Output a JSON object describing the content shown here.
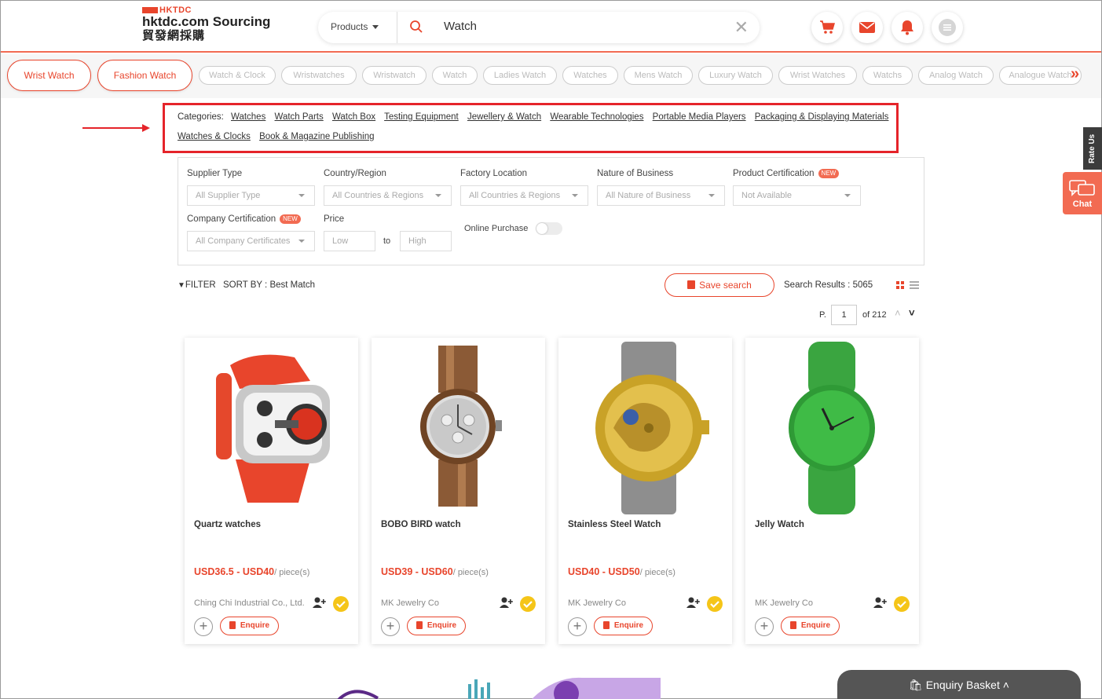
{
  "header": {
    "logo_mark": "HKTDC",
    "logo_site": "hktdc.com Sourcing",
    "logo_chinese": "貿發網採購",
    "search": {
      "category_label": "Products",
      "query": "Watch"
    },
    "icons": [
      "cart-icon",
      "mail-icon",
      "bell-icon",
      "menu-icon"
    ]
  },
  "chips": [
    {
      "label": "Wrist Watch",
      "active": true
    },
    {
      "label": "Fashion Watch",
      "active": true
    },
    {
      "label": "Watch & Clock",
      "active": false
    },
    {
      "label": "Wristwatches",
      "active": false
    },
    {
      "label": "Wristwatch",
      "active": false
    },
    {
      "label": "Watch",
      "active": false
    },
    {
      "label": "Ladies Watch",
      "active": false
    },
    {
      "label": "Watches",
      "active": false
    },
    {
      "label": "Mens Watch",
      "active": false
    },
    {
      "label": "Luxury Watch",
      "active": false
    },
    {
      "label": "Wrist Watches",
      "active": false
    },
    {
      "label": "Watchs",
      "active": false
    },
    {
      "label": "Analog Watch",
      "active": false
    },
    {
      "label": "Analogue Watch",
      "active": false
    }
  ],
  "categories": {
    "label": "Categories:",
    "line1": [
      "Watches",
      "Watch Parts",
      "Watch Box",
      "Testing Equipment",
      "Jewellery & Watch",
      "Wearable Technologies",
      "Portable Media Players",
      "Packaging & Displaying Materials"
    ],
    "line2": [
      "Watches & Clocks",
      "Book & Magazine Publishing"
    ]
  },
  "filters": {
    "supplier_type": {
      "label": "Supplier Type",
      "value": "All Supplier Type"
    },
    "country_region": {
      "label": "Country/Region",
      "value": "All Countries & Regions"
    },
    "factory_location": {
      "label": "Factory Location",
      "value": "All Countries & Regions"
    },
    "nature_of_business": {
      "label": "Nature of Business",
      "value": "All Nature of Business"
    },
    "product_certification": {
      "label": "Product Certification",
      "value": "Not Available",
      "badge": "NEW"
    },
    "company_certification": {
      "label": "Company Certification",
      "value": "All Company Certificates",
      "badge": "NEW"
    },
    "price": {
      "label": "Price",
      "low_placeholder": "Low",
      "to": "to",
      "high_placeholder": "High"
    },
    "online_purchase": {
      "label": "Online Purchase",
      "enabled": false
    }
  },
  "toolbar": {
    "filter_label": "FILTER",
    "sort_label": "SORT BY : Best Match",
    "save_search": "Save search",
    "results": "Search Results : 5065",
    "page_prefix": "P.",
    "page": "1",
    "page_total": "of 212"
  },
  "products": [
    {
      "title": "Quartz watches",
      "price": "USD36.5 - USD40",
      "unit": "/ piece(s)",
      "supplier": "Ching Chi Industrial Co., Ltd.",
      "enquire": "Enquire"
    },
    {
      "title": "BOBO BIRD watch",
      "price": "USD39 - USD60",
      "unit": "/ piece(s)",
      "supplier": "MK Jewelry Co",
      "enquire": "Enquire"
    },
    {
      "title": "Stainless Steel Watch",
      "price": "USD40 - USD50",
      "unit": "/ piece(s)",
      "supplier": "MK Jewelry Co",
      "enquire": "Enquire"
    },
    {
      "title": "Jelly Watch",
      "price": "",
      "unit": "",
      "supplier": "MK Jewelry Co",
      "enquire": "Enquire"
    }
  ],
  "side": {
    "rate_us": "Rate Us",
    "chat": "Chat"
  },
  "enquiry_basket": "Enquiry Basket",
  "colors": {
    "accent": "#e8452c",
    "highlight_box": "#e5242a"
  }
}
